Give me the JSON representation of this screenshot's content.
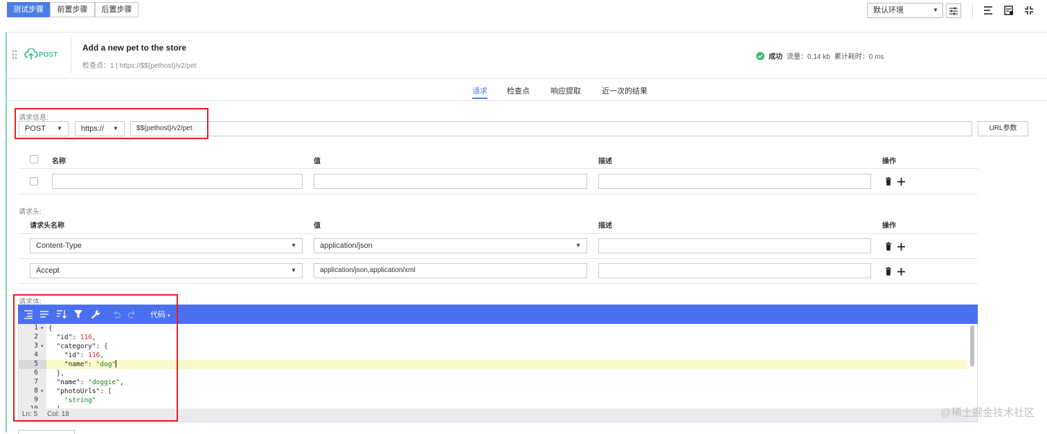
{
  "topbar": {
    "tabs": [
      "测试步骤",
      "前置步骤",
      "后置步骤"
    ],
    "env_select": "默认环境"
  },
  "step": {
    "method_badge": "POST",
    "title": "Add a new pet to the store",
    "meta": "检查点：1  |  https://$${pethost}/v2/pet",
    "status_label": "成功",
    "traffic": "流量：0.14 kb",
    "elapsed": "累计耗时：0 ms"
  },
  "tabs": [
    "请求",
    "检查点",
    "响应提取",
    "近一次的结果"
  ],
  "request_info": {
    "label": "请求信息:",
    "method": "POST",
    "protocol": "https://",
    "url": "$${pethost}/v2/pet",
    "url_params_button": "URL参数"
  },
  "params_table": {
    "headers": [
      "名称",
      "值",
      "描述",
      "操作"
    ]
  },
  "request_headers": {
    "label": "请求头:",
    "headers": [
      "请求头名称",
      "值",
      "描述",
      "操作"
    ],
    "rows": [
      {
        "name": "Content-Type",
        "value": "application/json"
      },
      {
        "name": "Accept",
        "value": "application/json,application/xml"
      }
    ]
  },
  "body": {
    "label": "请求体:",
    "code_menu": "代码",
    "line_numbers": [
      "1",
      "2",
      "3",
      "4",
      "5",
      "6",
      "7",
      "8",
      "9",
      "10"
    ],
    "status_ln": "Ln: 5",
    "status_col": "Col: 18"
  },
  "watermark": "@稀土掘金技术社区",
  "colors": {
    "accent": "#4a7ee6",
    "editor_toolbar": "#4a6ff0",
    "success": "#3bbf6a",
    "highlight_box": "#e02020"
  }
}
